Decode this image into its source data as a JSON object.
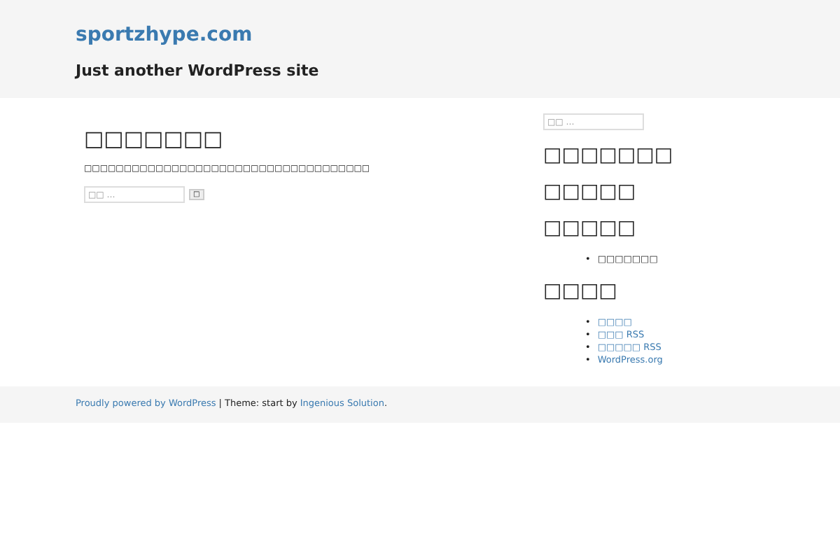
{
  "header": {
    "site_title": "sportzhype.com",
    "tagline": "Just another WordPress site"
  },
  "main": {
    "heading": "□□□□□□□",
    "message": "□□□□□□□□□□□□□□□□□□□□□□□□□□□□□□□□□□□□",
    "search": {
      "placeholder": "□□ …",
      "button": "□"
    }
  },
  "sidebar": {
    "search": {
      "placeholder": "□□ …"
    },
    "widgets": [
      {
        "title": "□□□□□□□"
      },
      {
        "title": "□□□□□"
      },
      {
        "title": "□□□□□",
        "items": [
          {
            "marker": "•",
            "label": "□□□□□□□",
            "kind": "text"
          }
        ]
      },
      {
        "title": "□□□□",
        "items": [
          {
            "marker": "•",
            "label": "□□□□",
            "kind": "link"
          },
          {
            "marker": "•",
            "label": "□□□ RSS",
            "kind": "link"
          },
          {
            "marker": "•",
            "label": "□□□□□ RSS",
            "kind": "link"
          },
          {
            "marker": "•",
            "label": "WordPress.org",
            "kind": "link"
          }
        ]
      }
    ]
  },
  "footer": {
    "powered": "Proudly powered by WordPress",
    "separator": "|",
    "theme_text": "Theme: start by",
    "author": "Ingenious Solution",
    "end": "."
  }
}
